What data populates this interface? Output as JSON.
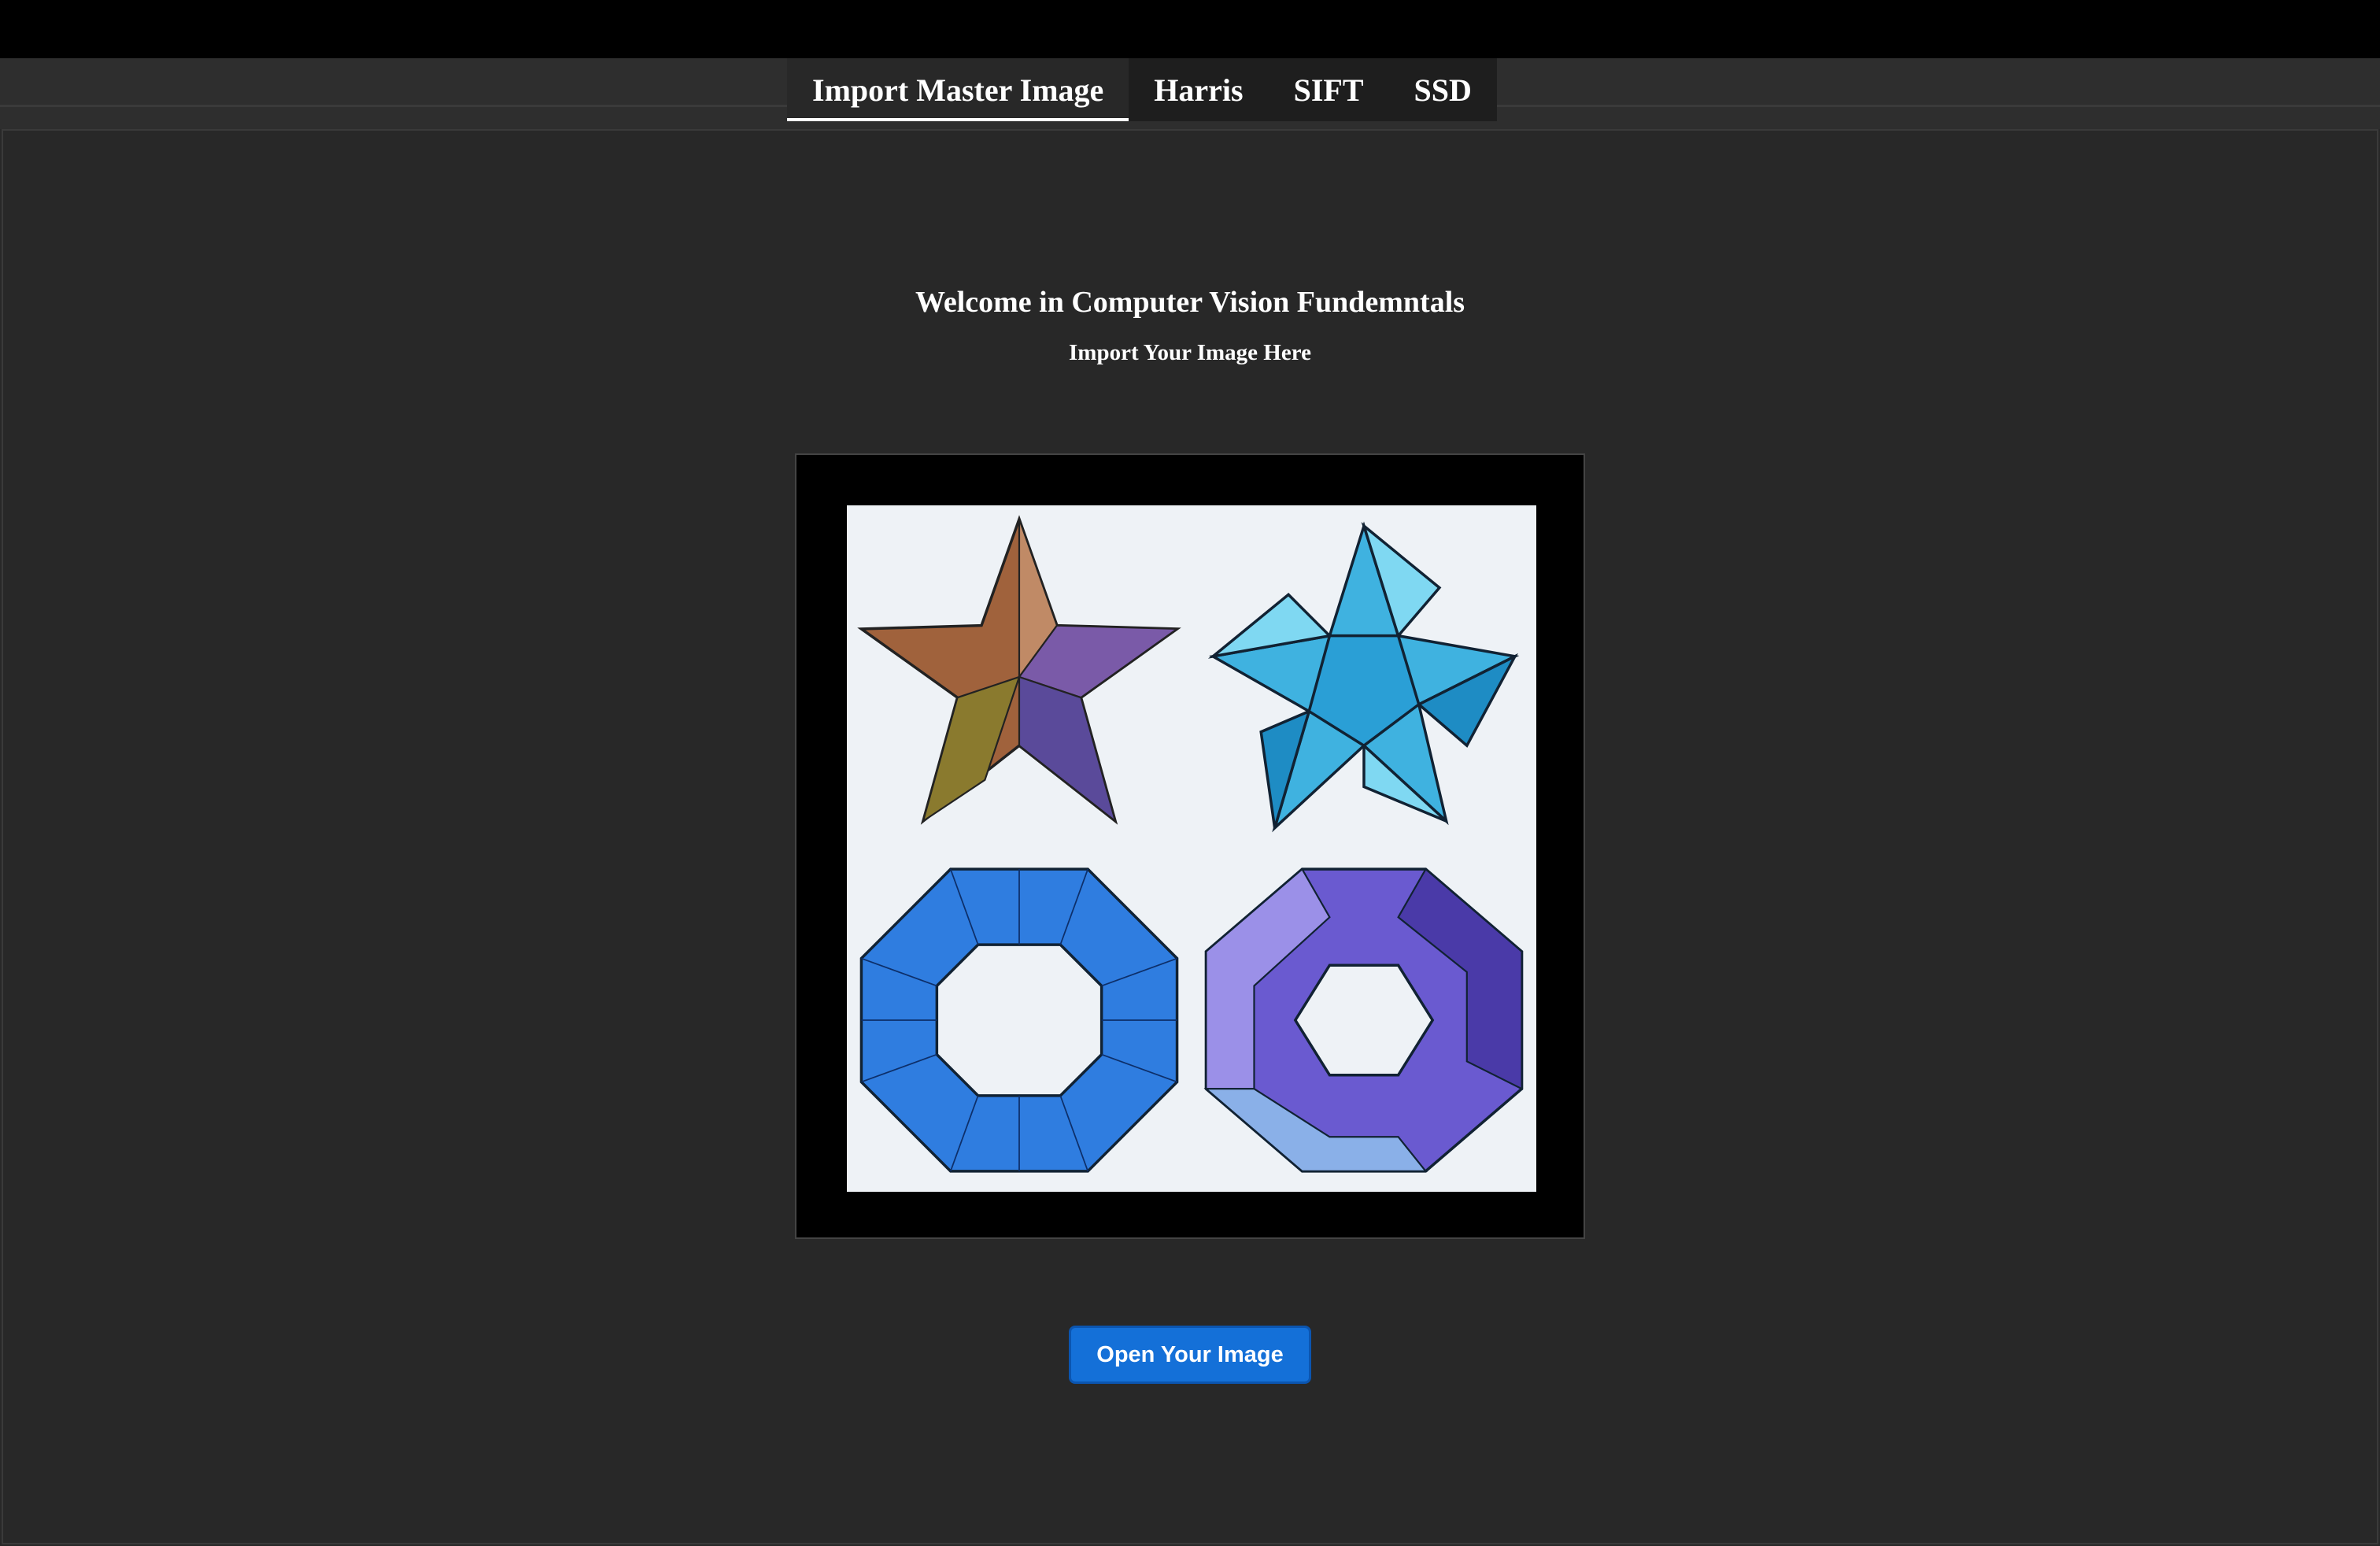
{
  "tabs": [
    {
      "label": "Import Master Image",
      "active": true
    },
    {
      "label": "Harris",
      "active": false
    },
    {
      "label": "SIFT",
      "active": false
    },
    {
      "label": "SSD",
      "active": false
    }
  ],
  "main": {
    "welcome": "Welcome in Computer Vision Fundemntals",
    "subtitle": "Import Your Image Here",
    "open_button_label": "Open Your Image"
  },
  "preview": {
    "tiles": [
      {
        "subject": "brown-purple-stellated-star",
        "colors": [
          "#a0623c",
          "#7a5aa8",
          "#8a7a2e"
        ]
      },
      {
        "subject": "light-blue-pinwheel-star",
        "colors": [
          "#3fb2e0",
          "#7fd8f2",
          "#1e8cc4"
        ]
      },
      {
        "subject": "blue-octagonal-torus",
        "colors": [
          "#2f7de0",
          "#5a9cf0",
          "#1c5cc0"
        ]
      },
      {
        "subject": "purple-twisted-ring",
        "colors": [
          "#6a5ad0",
          "#9b90e8",
          "#4a3aa8"
        ]
      }
    ]
  },
  "theme": {
    "background": "#282828",
    "accent": "#1470d8"
  }
}
